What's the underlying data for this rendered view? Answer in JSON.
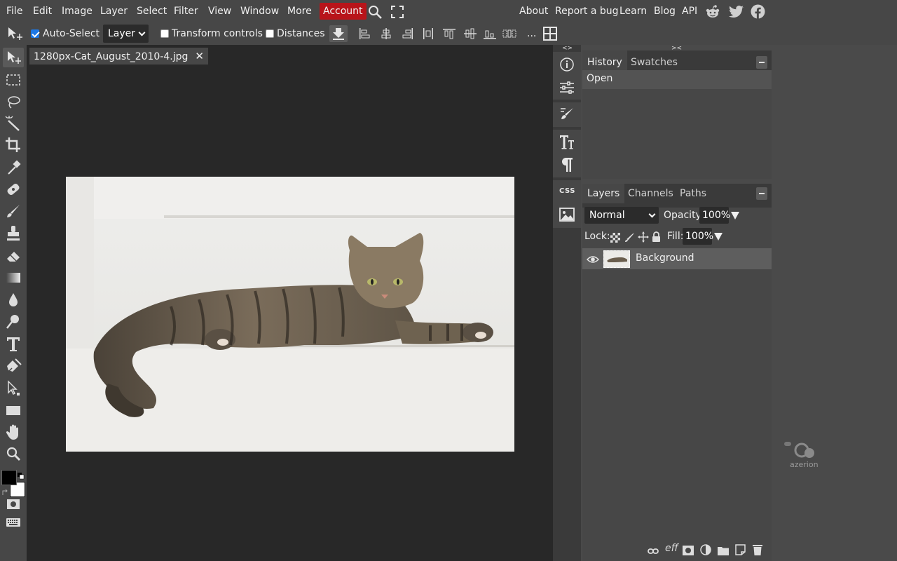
{
  "menubar": {
    "left_items": [
      "File",
      "Edit",
      "Image",
      "Layer",
      "Select",
      "Filter",
      "View",
      "Window",
      "More"
    ],
    "account_label": "Account",
    "right_items": [
      "About",
      "Report a bug",
      "Learn",
      "Blog",
      "API"
    ],
    "accent_color": "#b8141a",
    "icons": [
      "search-icon",
      "fullscreen-icon",
      "reddit-icon",
      "twitter-icon",
      "facebook-icon"
    ]
  },
  "options": {
    "auto_select_label": "Auto-Select",
    "auto_select_checked": true,
    "layer_select_value": "Layer",
    "transform_controls_label": "Transform controls",
    "transform_controls_checked": false,
    "distances_label": "Distances",
    "distances_checked": false,
    "more_label": "..."
  },
  "document": {
    "tab_title": "1280px-Cat_August_2010-4.jpg",
    "close_glyph": "✕"
  },
  "strip": {
    "css_label": "CSS"
  },
  "history_panel": {
    "tabs": [
      "History",
      "Swatches"
    ],
    "entries": [
      "Open"
    ]
  },
  "layers_panel": {
    "tabs": [
      "Layers",
      "Channels",
      "Paths"
    ],
    "blend_mode": "Normal",
    "opacity_label": "Opacity:",
    "opacity_value": "100%",
    "lock_label": "Lock:",
    "fill_label": "Fill:",
    "fill_value": "100%",
    "layers": [
      {
        "name": "Background",
        "visible": true
      }
    ],
    "footer_eff_label": "eff"
  },
  "colors": {
    "foreground": "#000000",
    "background": "#ffffff"
  },
  "watermark": {
    "text": "azerion"
  }
}
